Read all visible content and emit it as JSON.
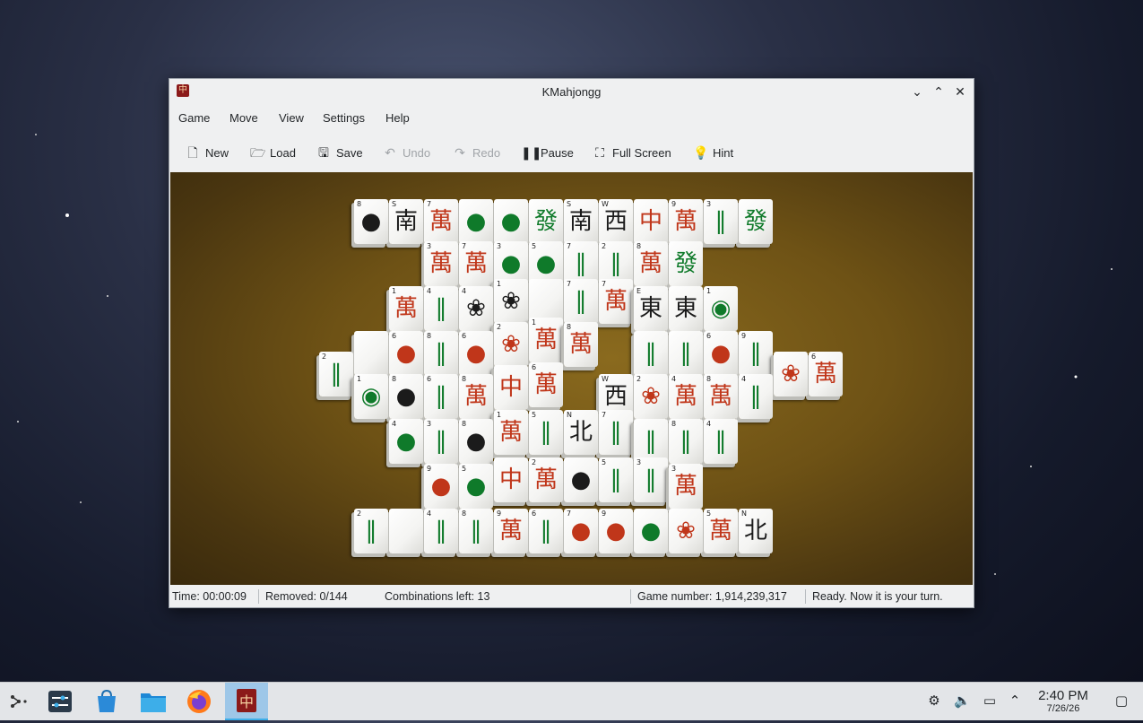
{
  "window": {
    "title": "KMahjongg",
    "app_icon": "mahjongg-icon",
    "controls": {
      "minimize": "chevron-down-icon",
      "maximize": "chevron-up-icon",
      "close": "close-icon"
    }
  },
  "menu": [
    "Game",
    "Move",
    "View",
    "Settings",
    "Help"
  ],
  "toolbar": {
    "new": "New",
    "load": "Load",
    "save": "Save",
    "undo": "Undo",
    "redo": "Redo",
    "pause": "Pause",
    "fullscreen": "Full Screen",
    "hint": "Hint"
  },
  "status": {
    "time": "Time: 00:00:09",
    "removed": "Removed: 0/144",
    "combinations": "Combinations left: 13",
    "game_number": "Game number: 1,914,239,317",
    "message": "Ready. Now it is your turn."
  },
  "tiles": [
    {
      "g": "●",
      "n": "8",
      "c": "black"
    },
    {
      "g": "南",
      "n": "S",
      "c": "black"
    },
    {
      "g": "萬",
      "n": "7",
      "c": "red"
    },
    {
      "g": "●",
      "n": "",
      "c": "green"
    },
    {
      "g": "●",
      "n": "",
      "c": "green"
    },
    {
      "g": "發",
      "n": "",
      "c": "green"
    },
    {
      "g": "南",
      "n": "S",
      "c": "black"
    },
    {
      "g": "西",
      "n": "W",
      "c": "black"
    },
    {
      "g": "中",
      "n": "",
      "c": "red"
    },
    {
      "g": "萬",
      "n": "9",
      "c": "red"
    },
    {
      "g": "‖",
      "n": "3",
      "c": "green"
    },
    {
      "g": "發",
      "n": "",
      "c": "green"
    },
    {
      "g": "萬",
      "n": "3",
      "c": "red"
    },
    {
      "g": "萬",
      "n": "7",
      "c": "red"
    },
    {
      "g": "●",
      "n": "3",
      "c": "green"
    },
    {
      "g": "●",
      "n": "5",
      "c": "green"
    },
    {
      "g": "‖",
      "n": "7",
      "c": "green"
    },
    {
      "g": "‖",
      "n": "2",
      "c": "green"
    },
    {
      "g": "萬",
      "n": "8",
      "c": "red"
    },
    {
      "g": "發",
      "n": "",
      "c": "green"
    },
    {
      "g": "萬",
      "n": "1",
      "c": "red"
    },
    {
      "g": "‖",
      "n": "4",
      "c": "green"
    },
    {
      "g": "❀",
      "n": "4",
      "c": "black"
    },
    {
      "g": "❀",
      "n": "1",
      "c": "black"
    },
    {
      "g": "",
      "n": "",
      "c": "black"
    },
    {
      "g": "‖",
      "n": "7",
      "c": "green"
    },
    {
      "g": "萬",
      "n": "7",
      "c": "red"
    },
    {
      "g": "東",
      "n": "E",
      "c": "black"
    },
    {
      "g": "東",
      "n": "",
      "c": "black"
    },
    {
      "g": "◉",
      "n": "1",
      "c": "green"
    },
    {
      "g": "",
      "n": "",
      "c": "black"
    },
    {
      "g": "●",
      "n": "6",
      "c": "red"
    },
    {
      "g": "‖",
      "n": "8",
      "c": "green"
    },
    {
      "g": "●",
      "n": "6",
      "c": "red"
    },
    {
      "g": "❀",
      "n": "2",
      "c": "red"
    },
    {
      "g": "萬",
      "n": "1",
      "c": "red"
    },
    {
      "g": "萬",
      "n": "8",
      "c": "red"
    },
    {
      "g": "‖",
      "n": "",
      "c": "green"
    },
    {
      "g": "‖",
      "n": "",
      "c": "green"
    },
    {
      "g": "●",
      "n": "6",
      "c": "red"
    },
    {
      "g": "‖",
      "n": "9",
      "c": "green"
    },
    {
      "g": "❀",
      "n": "",
      "c": "red"
    },
    {
      "g": "萬",
      "n": "6",
      "c": "red"
    },
    {
      "g": "‖",
      "n": "2",
      "c": "green"
    },
    {
      "g": "◉",
      "n": "1",
      "c": "green"
    },
    {
      "g": "●",
      "n": "8",
      "c": "black"
    },
    {
      "g": "‖",
      "n": "6",
      "c": "green"
    },
    {
      "g": "萬",
      "n": "8",
      "c": "red"
    },
    {
      "g": "中",
      "n": "",
      "c": "red"
    },
    {
      "g": "萬",
      "n": "6",
      "c": "red"
    },
    {
      "g": "西",
      "n": "W",
      "c": "black"
    },
    {
      "g": "❀",
      "n": "2",
      "c": "red"
    },
    {
      "g": "萬",
      "n": "4",
      "c": "red"
    },
    {
      "g": "萬",
      "n": "8",
      "c": "red"
    },
    {
      "g": "‖",
      "n": "4",
      "c": "green"
    },
    {
      "g": "●",
      "n": "4",
      "c": "green"
    },
    {
      "g": "‖",
      "n": "3",
      "c": "green"
    },
    {
      "g": "●",
      "n": "8",
      "c": "black"
    },
    {
      "g": "萬",
      "n": "1",
      "c": "red"
    },
    {
      "g": "‖",
      "n": "5",
      "c": "green"
    },
    {
      "g": "北",
      "n": "N",
      "c": "black"
    },
    {
      "g": "‖",
      "n": "7",
      "c": "green"
    },
    {
      "g": "‖",
      "n": "",
      "c": "green"
    },
    {
      "g": "‖",
      "n": "8",
      "c": "green"
    },
    {
      "g": "‖",
      "n": "4",
      "c": "green"
    },
    {
      "g": "●",
      "n": "9",
      "c": "red"
    },
    {
      "g": "●",
      "n": "5",
      "c": "green"
    },
    {
      "g": "中",
      "n": "",
      "c": "red"
    },
    {
      "g": "萬",
      "n": "2",
      "c": "red"
    },
    {
      "g": "●",
      "n": "",
      "c": "black"
    },
    {
      "g": "‖",
      "n": "5",
      "c": "green"
    },
    {
      "g": "‖",
      "n": "3",
      "c": "green"
    },
    {
      "g": "萬",
      "n": "3",
      "c": "red"
    },
    {
      "g": "‖",
      "n": "2",
      "c": "green"
    },
    {
      "g": "",
      "n": "",
      "c": "black"
    },
    {
      "g": "‖",
      "n": "4",
      "c": "green"
    },
    {
      "g": "‖",
      "n": "8",
      "c": "green"
    },
    {
      "g": "萬",
      "n": "9",
      "c": "red"
    },
    {
      "g": "‖",
      "n": "6",
      "c": "green"
    },
    {
      "g": "●",
      "n": "7",
      "c": "red"
    },
    {
      "g": "●",
      "n": "9",
      "c": "red"
    },
    {
      "g": "●",
      "n": "",
      "c": "green"
    },
    {
      "g": "❀",
      "n": "",
      "c": "red"
    },
    {
      "g": "萬",
      "n": "5",
      "c": "red"
    },
    {
      "g": "北",
      "n": "N",
      "c": "black"
    }
  ],
  "taskbar": {
    "items": [
      "launcher-icon",
      "settings-icon",
      "store-icon",
      "files-icon",
      "firefox-icon",
      "kmahjongg-icon"
    ],
    "tray": [
      "network-icon",
      "volume-icon",
      "display-icon",
      "chevron-up-icon"
    ],
    "time": "2:40 PM",
    "date": "7/26/26"
  }
}
